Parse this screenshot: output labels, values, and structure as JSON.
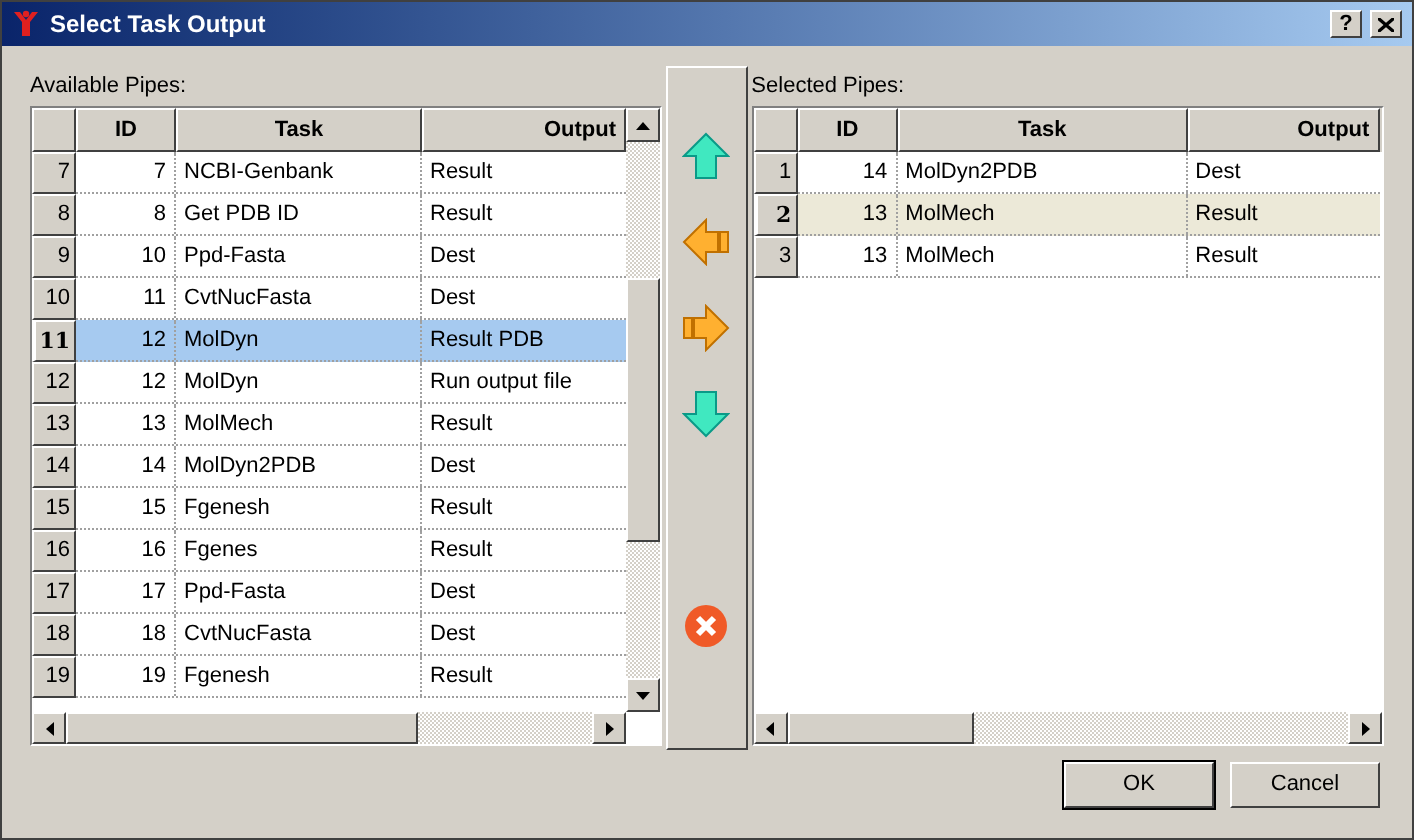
{
  "window": {
    "title": "Select Task Output",
    "help": "?"
  },
  "available": {
    "label": "Available Pipes:",
    "columns": [
      "ID",
      "Task",
      "Output"
    ],
    "rows": [
      {
        "num": "7",
        "id": "7",
        "task": "NCBI-Genbank",
        "output": "Result",
        "selected": false
      },
      {
        "num": "8",
        "id": "8",
        "task": "Get PDB ID",
        "output": "Result",
        "selected": false
      },
      {
        "num": "9",
        "id": "10",
        "task": "Ppd-Fasta",
        "output": "Dest",
        "selected": false
      },
      {
        "num": "10",
        "id": "11",
        "task": "CvtNucFasta",
        "output": "Dest",
        "selected": false
      },
      {
        "num": "11",
        "id": "12",
        "task": "MolDyn",
        "output": "Result PDB",
        "selected": true
      },
      {
        "num": "12",
        "id": "12",
        "task": "MolDyn",
        "output": "Run output file",
        "selected": false
      },
      {
        "num": "13",
        "id": "13",
        "task": "MolMech",
        "output": "Result",
        "selected": false
      },
      {
        "num": "14",
        "id": "14",
        "task": "MolDyn2PDB",
        "output": "Dest",
        "selected": false
      },
      {
        "num": "15",
        "id": "15",
        "task": "Fgenesh",
        "output": "Result",
        "selected": false
      },
      {
        "num": "16",
        "id": "16",
        "task": "Fgenes",
        "output": "Result",
        "selected": false
      },
      {
        "num": "17",
        "id": "17",
        "task": "Ppd-Fasta",
        "output": "Dest",
        "selected": false
      },
      {
        "num": "18",
        "id": "18",
        "task": "CvtNucFasta",
        "output": "Dest",
        "selected": false
      },
      {
        "num": "19",
        "id": "19",
        "task": "Fgenesh",
        "output": "Result",
        "selected": false
      }
    ]
  },
  "selected": {
    "label": "Selected Pipes:",
    "columns": [
      "ID",
      "Task",
      "Output"
    ],
    "rows": [
      {
        "num": "1",
        "id": "14",
        "task": "MolDyn2PDB",
        "output": "Dest",
        "selected": false
      },
      {
        "num": "2",
        "id": "13",
        "task": "MolMech",
        "output": "Result",
        "selected": true
      },
      {
        "num": "3",
        "id": "13",
        "task": "MolMech",
        "output": "Result",
        "selected": false
      }
    ]
  },
  "buttons": [
    "OK",
    "Cancel"
  ]
}
